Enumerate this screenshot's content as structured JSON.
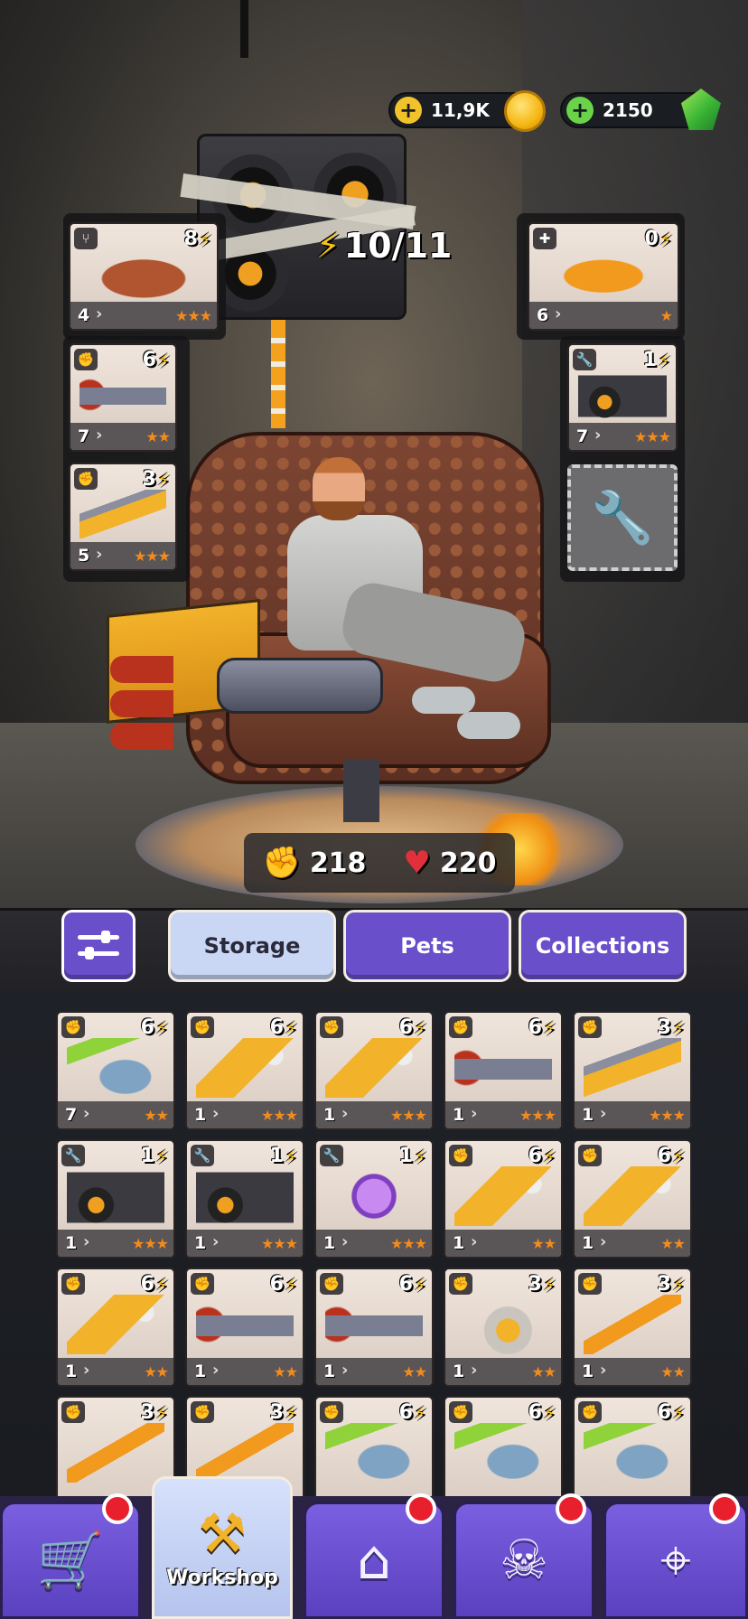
{
  "currency": {
    "coins": "11,9K",
    "gems": "2150",
    "add_symbol": "+"
  },
  "energy": {
    "value": "10/11"
  },
  "stats": {
    "attack": "218",
    "health": "220"
  },
  "equipped": {
    "left": [
      {
        "name": "armchair",
        "type_icon": "chair-icon",
        "cost": "8",
        "count": "4",
        "stars": 3
      },
      {
        "name": "minigun",
        "type_icon": "fist-icon",
        "cost": "6",
        "count": "7",
        "stars": 2
      },
      {
        "name": "cannon",
        "type_icon": "fist-icon",
        "cost": "3",
        "count": "5",
        "stars": 3
      }
    ],
    "right": [
      {
        "name": "gamepad",
        "type_icon": "gamepad-icon",
        "cost": "0",
        "count": "6",
        "stars": 1
      },
      {
        "name": "speaker",
        "type_icon": "wrench-icon",
        "cost": "1",
        "count": "7",
        "stars": 3
      }
    ]
  },
  "tabs": {
    "storage": "Storage",
    "pets": "Pets",
    "collections": "Collections"
  },
  "storage_items": [
    {
      "name": "shark-gun",
      "type_icon": "fist-icon",
      "cost": "6",
      "count": "7",
      "stars": 2
    },
    {
      "name": "drill-gun",
      "type_icon": "fist-icon",
      "cost": "6",
      "count": "1",
      "stars": 3
    },
    {
      "name": "drill-gun",
      "type_icon": "fist-icon",
      "cost": "6",
      "count": "1",
      "stars": 3
    },
    {
      "name": "minigun",
      "type_icon": "fist-icon",
      "cost": "6",
      "count": "1",
      "stars": 3
    },
    {
      "name": "cannon",
      "type_icon": "fist-icon",
      "cost": "3",
      "count": "1",
      "stars": 3
    },
    {
      "name": "speaker",
      "type_icon": "wrench-icon",
      "cost": "1",
      "count": "1",
      "stars": 3
    },
    {
      "name": "speaker",
      "type_icon": "wrench-icon",
      "cost": "1",
      "count": "1",
      "stars": 3
    },
    {
      "name": "disco-ball",
      "type_icon": "wrench-icon",
      "cost": "1",
      "count": "1",
      "stars": 3
    },
    {
      "name": "drill-gun",
      "type_icon": "fist-icon",
      "cost": "6",
      "count": "1",
      "stars": 2
    },
    {
      "name": "drill-gun",
      "type_icon": "fist-icon",
      "cost": "6",
      "count": "1",
      "stars": 2
    },
    {
      "name": "drill-gun",
      "type_icon": "fist-icon",
      "cost": "6",
      "count": "1",
      "stars": 2
    },
    {
      "name": "minigun",
      "type_icon": "fist-icon",
      "cost": "6",
      "count": "1",
      "stars": 2
    },
    {
      "name": "minigun",
      "type_icon": "fist-icon",
      "cost": "6",
      "count": "1",
      "stars": 2
    },
    {
      "name": "saw-blade",
      "type_icon": "fist-icon",
      "cost": "3",
      "count": "1",
      "stars": 2
    },
    {
      "name": "spiked-bat",
      "type_icon": "fist-icon",
      "cost": "3",
      "count": "1",
      "stars": 2
    },
    {
      "name": "spiked-bat",
      "type_icon": "fist-icon",
      "cost": "3",
      "count": "",
      "stars": 0
    },
    {
      "name": "spiked-bat",
      "type_icon": "fist-icon",
      "cost": "3",
      "count": "",
      "stars": 0
    },
    {
      "name": "shark-gun",
      "type_icon": "fist-icon",
      "cost": "6",
      "count": "",
      "stars": 0
    },
    {
      "name": "shark-gun",
      "type_icon": "fist-icon",
      "cost": "6",
      "count": "",
      "stars": 0
    },
    {
      "name": "shark-gun",
      "type_icon": "fist-icon",
      "cost": "6",
      "count": "",
      "stars": 0
    }
  ],
  "nav": {
    "shop_icon": "cart-icon",
    "workshop": "Workshop",
    "home_icon": "house-icon",
    "battle_icon": "skull-icon",
    "targets_icon": "crosshair-icon"
  },
  "colors": {
    "accent_purple": "#6a4fcb",
    "active_tab": "#c9d6f4",
    "star": "#f28b1f",
    "bolt": "#f6c21b",
    "badge_red": "#e8202e"
  }
}
